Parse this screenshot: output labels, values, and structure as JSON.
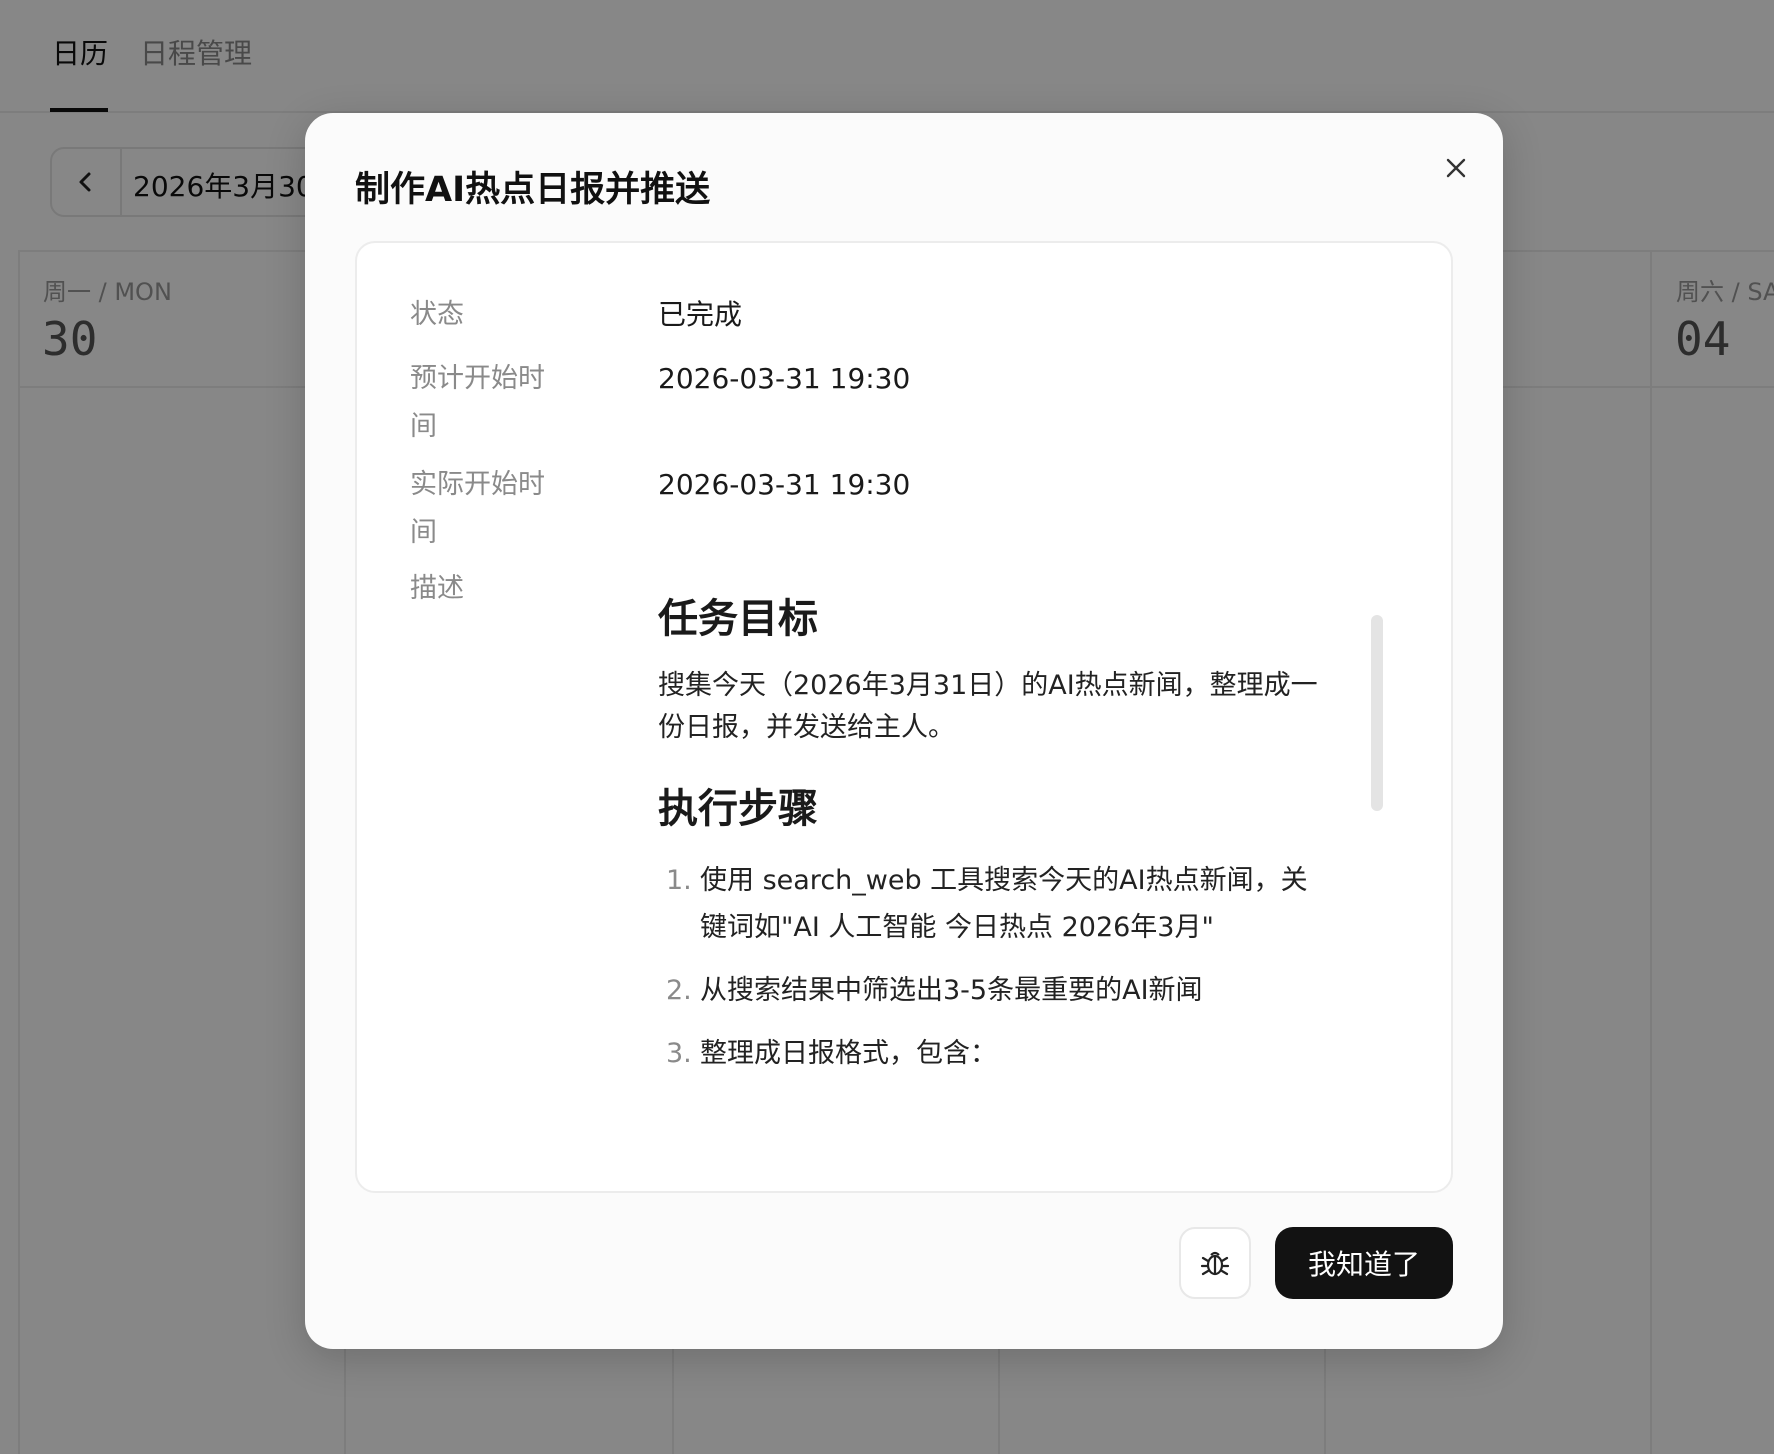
{
  "tabs": [
    {
      "label": "日历",
      "active": true
    },
    {
      "label": "日程管理",
      "active": false
    }
  ],
  "date_nav": {
    "current": "2026年3月30"
  },
  "week": {
    "first_day": {
      "label": "周一 / MON",
      "num": "30"
    },
    "last_day": {
      "label": "周六 / SA",
      "num": "04"
    }
  },
  "modal": {
    "title": "制作AI热点日报并推送",
    "fields": {
      "status_label": "状态",
      "status_value": "已完成",
      "planned_label_1": "预计开始时",
      "planned_label_2": "间",
      "planned_value": "2026-03-31 19:30",
      "actual_label_1": "实际开始时",
      "actual_label_2": "间",
      "actual_value": "2026-03-31 19:30",
      "desc_label": "描述"
    },
    "description": {
      "goal_heading": "任务目标",
      "goal_line1": "搜集今天（2026年3月31日）的AI热点新闻，整理成一",
      "goal_line2": "份日报，并发送给主人。",
      "steps_heading": "执行步骤",
      "steps": [
        {
          "num": "1.",
          "line1": "使用 search_web 工具搜索今天的AI热点新闻，关",
          "line2": "键词如\"AI 人工智能 今日热点 2026年3月\""
        },
        {
          "num": "2.",
          "line1": "从搜索结果中筛选出3-5条最重要的AI新闻",
          "line2": ""
        },
        {
          "num": "3.",
          "line1": "整理成日报格式，包含：",
          "line2": ""
        }
      ]
    },
    "buttons": {
      "bug_icon": "bug-icon",
      "ok_label": "我知道了"
    }
  },
  "colors": {
    "overlay": "#000000",
    "primary_button": "#121212",
    "muted_text": "#8a8a8a"
  }
}
